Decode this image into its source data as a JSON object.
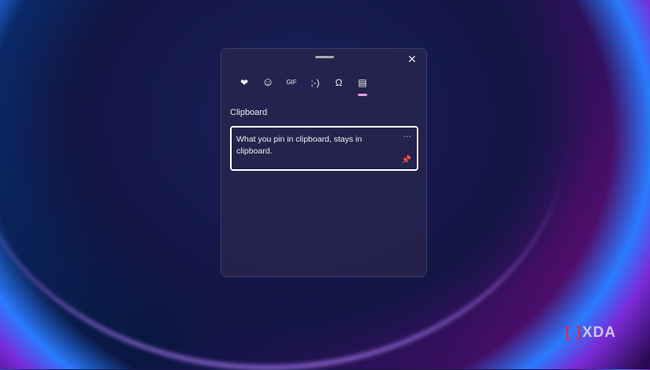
{
  "panel": {
    "close_icon": "close-icon",
    "tabs": [
      {
        "name": "tab-recently-used",
        "icon": "heart-card-icon",
        "glyph": "❤"
      },
      {
        "name": "tab-emoji",
        "icon": "smiley-icon",
        "glyph": "☺"
      },
      {
        "name": "tab-gif",
        "icon": "gif-icon",
        "glyph": "GIF"
      },
      {
        "name": "tab-kaomoji",
        "icon": "kaomoji-icon",
        "glyph": ";-)"
      },
      {
        "name": "tab-symbols",
        "icon": "symbols-icon",
        "glyph": "Ω"
      },
      {
        "name": "tab-clipboard",
        "icon": "clipboard-icon",
        "glyph": "▤"
      }
    ],
    "section_title": "Clipboard",
    "items": [
      {
        "text": "What you pin in clipboard, stays in clipboard.",
        "more": "···",
        "pin": "📌"
      }
    ]
  },
  "watermark": "XDA"
}
